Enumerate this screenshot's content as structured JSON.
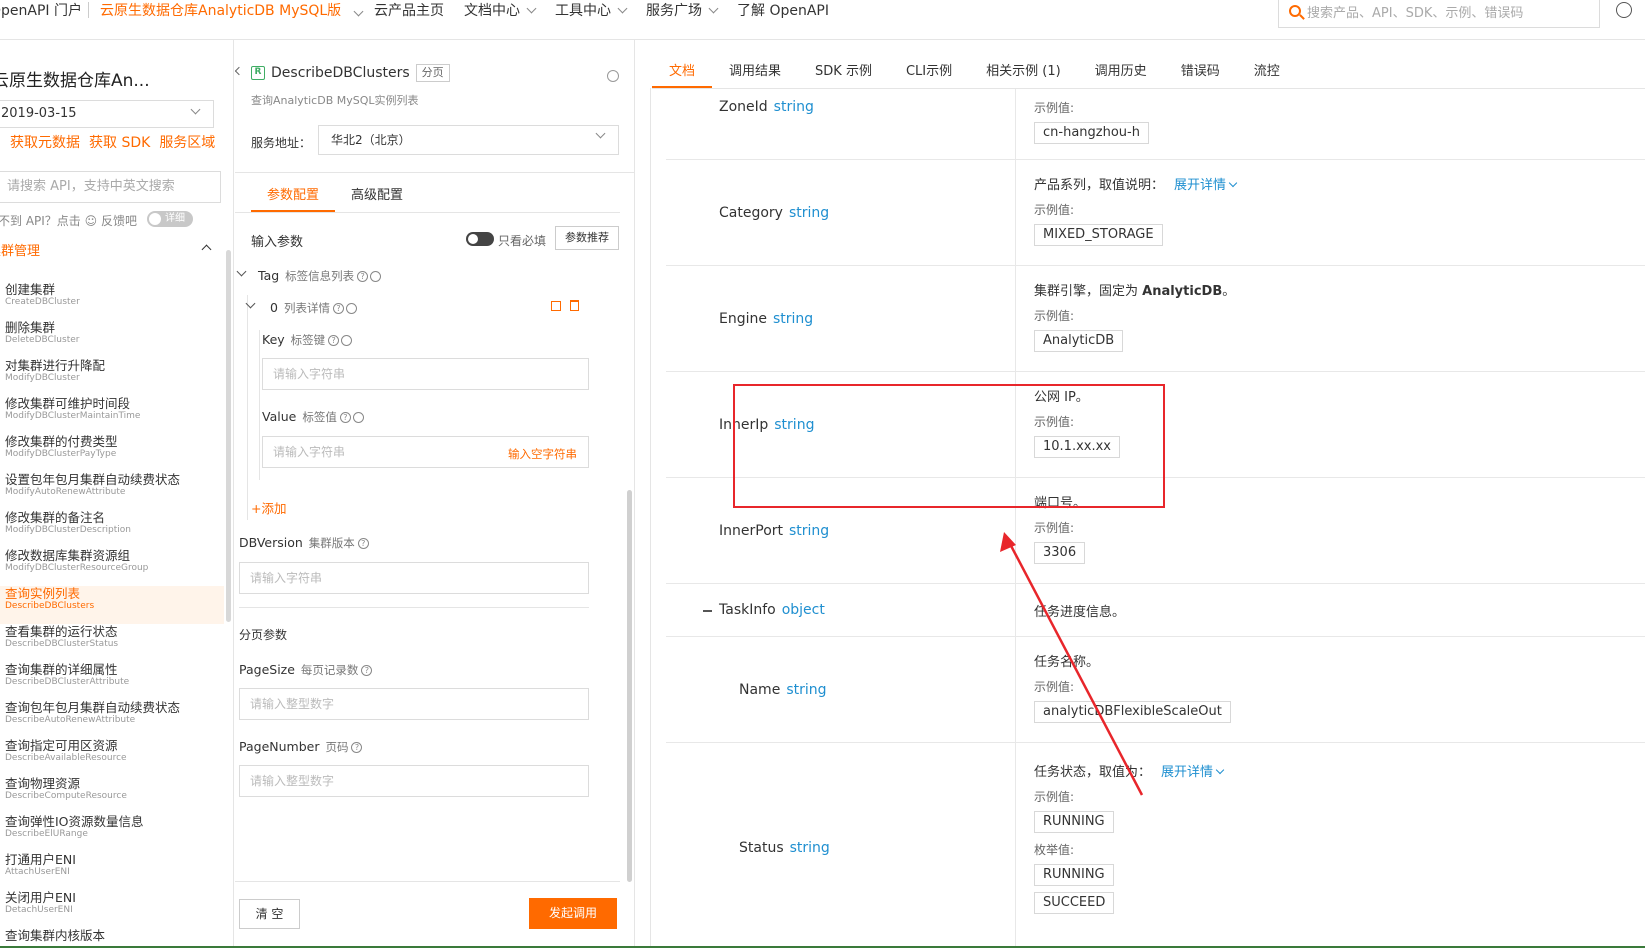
{
  "topbar": {
    "brand": "OpenAPI 门户",
    "product": "云原生数据仓库AnalyticDB MySQL版",
    "nav": [
      "云产品主页",
      "文档中心",
      "工具中心",
      "服务广场",
      "了解 OpenAPI"
    ],
    "search_placeholder": "搜索产品、API、SDK、示例、错误码"
  },
  "sidebar": {
    "title": "云原生数据仓库An...",
    "version": "2019-03-15",
    "links": [
      "获取元数据",
      "获取 SDK",
      "服务区域"
    ],
    "search_placeholder": "请搜索 API，支持中英文搜索",
    "feedback": "找不到 API？点击 ☺ 反馈吧",
    "toggle_label": "详细",
    "group": "集群管理",
    "items": [
      {
        "cn": "创建集群",
        "en": "CreateDBCluster"
      },
      {
        "cn": "删除集群",
        "en": "DeleteDBCluster"
      },
      {
        "cn": "对集群进行升降配",
        "en": "ModifyDBCluster"
      },
      {
        "cn": "修改集群可维护时间段",
        "en": "ModifyDBClusterMaintainTime"
      },
      {
        "cn": "修改集群的付费类型",
        "en": "ModifyDBClusterPayType"
      },
      {
        "cn": "设置包年包月集群自动续费状态",
        "en": "ModifyAutoRenewAttribute"
      },
      {
        "cn": "修改集群的备注名",
        "en": "ModifyDBClusterDescription"
      },
      {
        "cn": "修改数据库集群资源组",
        "en": "ModifyDBClusterResourceGroup"
      },
      {
        "cn": "查询实例列表",
        "en": "DescribeDBClusters"
      },
      {
        "cn": "查看集群的运行状态",
        "en": "DescribeDBClusterStatus"
      },
      {
        "cn": "查询集群的详细属性",
        "en": "DescribeDBClusterAttribute"
      },
      {
        "cn": "查询包年包月集群自动续费状态",
        "en": "DescribeAutoRenewAttribute"
      },
      {
        "cn": "查询指定可用区资源",
        "en": "DescribeAvailableResource"
      },
      {
        "cn": "查询物理资源",
        "en": "DescribeComputeResource"
      },
      {
        "cn": "查询弹性IO资源数量信息",
        "en": "DescribeElURange"
      },
      {
        "cn": "打通用户ENI",
        "en": "AttachUserENI"
      },
      {
        "cn": "关闭用户ENI",
        "en": "DetachUserENI"
      },
      {
        "cn": "查询集群内核版本",
        "en": ""
      }
    ]
  },
  "middle": {
    "api_name": "DescribeDBClusters",
    "api_tag": "分页",
    "api_desc": "查询AnalyticDB MySQL实例列表",
    "service_label": "服务地址：",
    "service_value": "华北2（北京）",
    "tabs": [
      "参数配置",
      "高级配置"
    ],
    "input_label": "输入参数",
    "required_only": "只看必填",
    "param_recommend": "参数推荐",
    "tag": {
      "name": "Tag",
      "desc": "标签信息列表"
    },
    "list_item": {
      "name": "0",
      "desc": "列表详情"
    },
    "key": {
      "name": "Key",
      "desc": "标签键",
      "placeholder": "请输入字符串"
    },
    "value": {
      "name": "Value",
      "desc": "标签值",
      "placeholder": "请输入字符串",
      "empty_string": "输入空字符串"
    },
    "add": "+添加",
    "dbversion": {
      "name": "DBVersion",
      "desc": "集群版本",
      "placeholder": "请输入字符串"
    },
    "page_section": "分页参数",
    "pagesize": {
      "name": "PageSize",
      "desc": "每页记录数",
      "placeholder": "请输入整型数字"
    },
    "pagenumber": {
      "name": "PageNumber",
      "desc": "页码",
      "placeholder": "请输入整型数字"
    },
    "clear": "清 空",
    "call": "发起调用"
  },
  "right": {
    "tabs": [
      "文档",
      "调用结果",
      "SDK 示例",
      "CLI示例",
      "相关示例 (1)",
      "调用历史",
      "错误码",
      "流控"
    ],
    "example_label": "示例值:",
    "enum_label": "枚举值:",
    "expand": "展开详情",
    "rows": [
      {
        "name": "ZoneId",
        "type": "string",
        "example": "cn-hangzhou-h"
      },
      {
        "name": "Category",
        "type": "string",
        "desc": "产品系列，取值说明：",
        "example": "MIXED_STORAGE"
      },
      {
        "name": "Engine",
        "type": "string",
        "desc": "集群引擎，固定为 ",
        "desc_bold": "AnalyticDB",
        "desc_end": "。",
        "example": "AnalyticDB"
      },
      {
        "name": "InnerIp",
        "type": "string",
        "desc": "公网 IP。",
        "example": "10.1.xx.xx"
      },
      {
        "name": "InnerPort",
        "type": "string",
        "desc": "端口号。",
        "example": "3306"
      },
      {
        "name": "TaskInfo",
        "type": "object",
        "desc": "任务进度信息。"
      },
      {
        "name": "Name",
        "type": "string",
        "desc": "任务名称。",
        "example": "analyticDBFlexibleScaleOut"
      },
      {
        "name": "Status",
        "type": "string",
        "desc": "任务状态，取值为：",
        "example": "RUNNING",
        "enums": [
          "RUNNING",
          "SUCCEED"
        ]
      }
    ]
  }
}
